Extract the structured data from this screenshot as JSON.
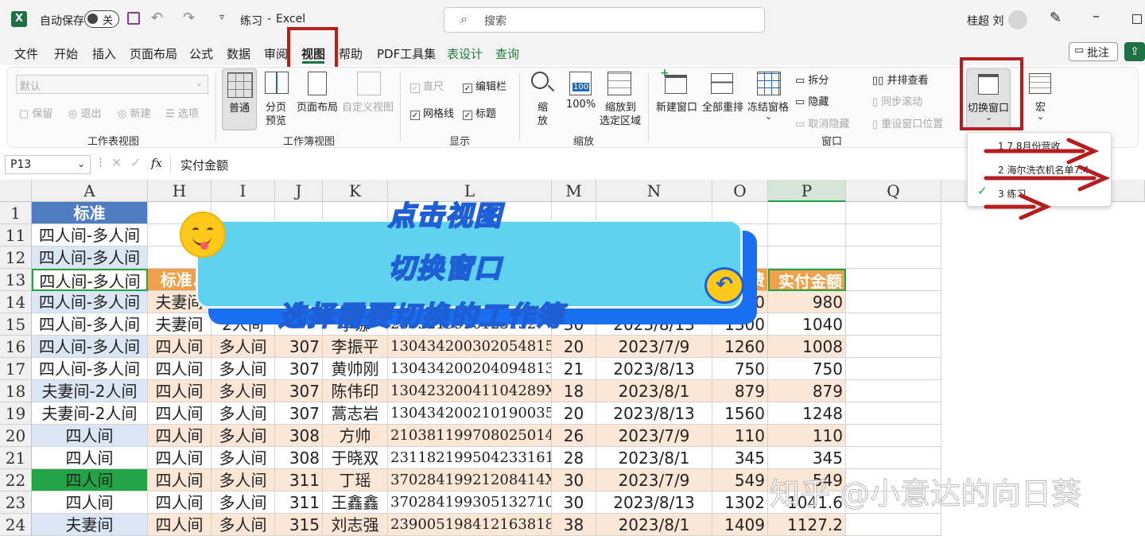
{
  "titlebar": {
    "autosave": "自动保存",
    "toggle": "关",
    "filename": "练习",
    "app": "Excel",
    "search": "搜索",
    "user": "桂超 刘"
  },
  "menu": [
    "文件",
    "开始",
    "插入",
    "页面布局",
    "公式",
    "数据",
    "审阅",
    "视图",
    "帮助",
    "PDF工具集",
    "表设计",
    "查询"
  ],
  "comment_button": "批注",
  "ribbon": {
    "sheetview": {
      "dropdown": "默认",
      "keep": "保留",
      "exit": "退出",
      "new": "新建",
      "options": "选项",
      "group": "工作表视图"
    },
    "workbookview": {
      "normal": "普通",
      "pagebreak1": "分页",
      "pagebreak2": "预览",
      "pagelayout": "页面布局",
      "custom": "自定义视图",
      "group": "工作簿视图"
    },
    "show": {
      "ruler": "直尺",
      "formulabar": "编辑栏",
      "gridlines": "网格线",
      "headings": "标题",
      "group": "显示"
    },
    "zoom": {
      "zoom1": "缩",
      "zoom2": "放",
      "hundred": "100%",
      "sel1": "缩放到",
      "sel2": "选定区域",
      "group": "缩放",
      "icon100": "100"
    },
    "window": {
      "newwin": "新建窗口",
      "arrange": "全部重排",
      "freeze": "冻结窗格",
      "split": "拆分",
      "hide": "隐藏",
      "unhide": "取消隐藏",
      "side": "并排查看",
      "sync": "同步滚动",
      "reset": "重设窗口位置",
      "switch": "切换窗口",
      "group": "窗口"
    },
    "macro": {
      "label": "宏"
    }
  },
  "dropdown": {
    "items": [
      "1 7.8月份营收",
      "2 海尔洗衣机名单7.4",
      "3 练习"
    ]
  },
  "formula": {
    "namebox": "P13",
    "fx": "fx",
    "value": "实付金额"
  },
  "columns": [
    "A",
    "H",
    "I",
    "J",
    "K",
    "L",
    "M",
    "N",
    "O",
    "P",
    "Q"
  ],
  "rows": [
    {
      "n": "1",
      "a": "标准"
    },
    {
      "n": "11",
      "a": "四人间-多人间"
    },
    {
      "n": "12",
      "a": "四人间-多人间"
    },
    {
      "n": "13",
      "a": "四人间-多人间",
      "h": "标准.",
      "o": "费",
      "p": "实付金额"
    },
    {
      "n": "14",
      "a": "四人间-多人间",
      "h": "夫妻间",
      "o": "980",
      "p": "980"
    },
    {
      "n": "15",
      "a": "四人间-多人间",
      "h": "夫妻间",
      "i": "2人间",
      "k": "李娜",
      "l": "2303219990123152",
      "m": "30",
      "nn": "2023/8/13",
      "o": "1300",
      "p": "1040"
    },
    {
      "n": "16",
      "a": "四人间-多人间",
      "h": "四人间",
      "i": "多人间",
      "j": "307",
      "k": "李振平",
      "l": "130434200302054815",
      "m": "20",
      "nn": "2023/7/9",
      "o": "1260",
      "p": "1008"
    },
    {
      "n": "17",
      "a": "四人间-多人间",
      "h": "四人间",
      "i": "多人间",
      "j": "307",
      "k": "黄帅刚",
      "l": "130434200204094813",
      "m": "21",
      "nn": "2023/8/13",
      "o": "750",
      "p": "750"
    },
    {
      "n": "18",
      "a": "夫妻间-2人间",
      "h": "四人间",
      "i": "多人间",
      "j": "307",
      "k": "陈伟印",
      "l": "13042320041104289X",
      "m": "18",
      "nn": "2023/8/1",
      "o": "879",
      "p": "879"
    },
    {
      "n": "19",
      "a": "夫妻间-2人间",
      "h": "四人间",
      "i": "多人间",
      "j": "307",
      "k": "蒿志岩",
      "l": "130434200210190035",
      "m": "20",
      "nn": "2023/8/13",
      "o": "1560",
      "p": "1248"
    },
    {
      "n": "20",
      "a": "四人间",
      "h": "四人间",
      "i": "多人间",
      "j": "308",
      "k": "方帅",
      "l": "210381199708025014",
      "m": "26",
      "nn": "2023/7/9",
      "o": "110",
      "p": "110"
    },
    {
      "n": "21",
      "a": "四人间",
      "h": "四人间",
      "i": "多人间",
      "j": "308",
      "k": "于晓双",
      "l": "231182199504233161",
      "m": "28",
      "nn": "2023/8/1",
      "o": "345",
      "p": "345"
    },
    {
      "n": "22",
      "a": "四人间",
      "h": "四人间",
      "i": "多人间",
      "j": "311",
      "k": "丁瑶",
      "l": "37028419921208414X",
      "m": "30",
      "nn": "2023/7/9",
      "o": "549",
      "p": "549"
    },
    {
      "n": "23",
      "a": "四人间",
      "h": "四人间",
      "i": "多人间",
      "j": "311",
      "k": "王鑫鑫",
      "l": "370284199305132710",
      "m": "30",
      "nn": "2023/8/13",
      "o": "1302",
      "p": "1041.6"
    },
    {
      "n": "24",
      "a": "夫妻间",
      "h": "四人间",
      "i": "多人间",
      "j": "315",
      "k": "刘志强",
      "l": "239005198412163818",
      "m": "38",
      "nn": "2023/8/1",
      "o": "1409",
      "p": "1127.2"
    }
  ],
  "banner": {
    "line1": "点击视图",
    "line2": "切换窗口",
    "line3": "选择需要切换的工作簿"
  },
  "watermark": "知乎 @小意达的向日葵",
  "colors": {
    "accent_red": "#b41e1e",
    "header_blue": "#4f7dc3",
    "header_orange": "#f0a04b",
    "band_orange": "#fce6d6",
    "band_blue": "#dbe6f4",
    "selected_green": "#21a346"
  }
}
